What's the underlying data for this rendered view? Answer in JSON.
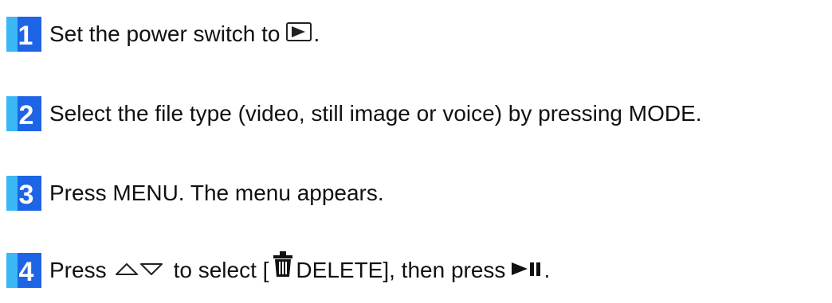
{
  "steps": [
    {
      "number": "1",
      "text_before": "Set the power switch to",
      "icon": "play-button-icon",
      "text_after": "."
    },
    {
      "number": "2",
      "text": "Select the file type (video, still image or voice) by pressing MODE."
    },
    {
      "number": "3",
      "text": "Press MENU. The menu appears."
    },
    {
      "number": "4",
      "text_press": "Press",
      "icon_arrows": "up-down-triangle-icon",
      "text_select": "to select [",
      "icon_trash": "trash-icon",
      "text_delete": "DELETE], then press",
      "icon_playpause": "play-pause-icon",
      "text_end": "."
    }
  ],
  "colors": {
    "badge_blue": "#1e64e6",
    "badge_cyan": "#3ab8f5",
    "badge_number": "#ffffff",
    "text": "#111111"
  }
}
